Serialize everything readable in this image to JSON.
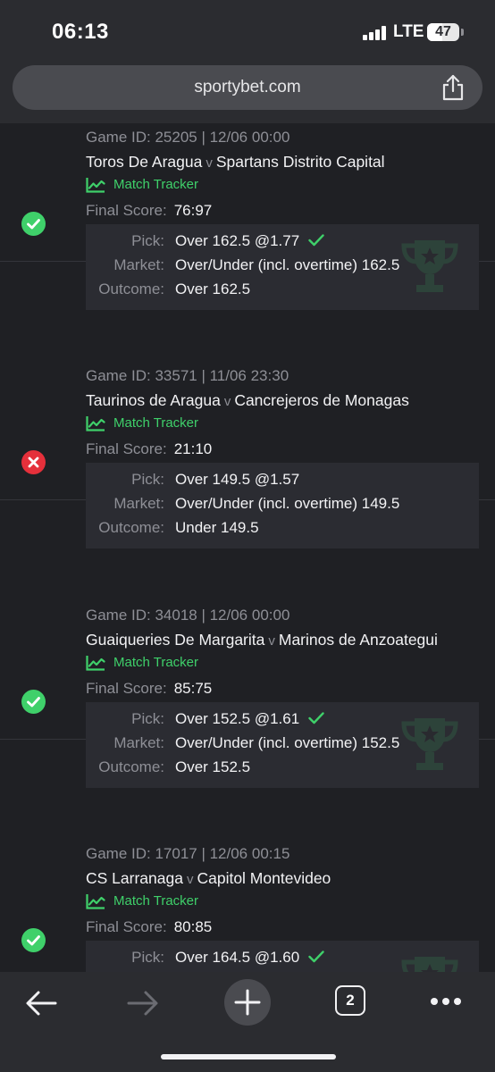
{
  "status_bar": {
    "time": "06:13",
    "network": "LTE",
    "battery": "47",
    "battery_level": 0.47
  },
  "browser": {
    "url": "sportybet.com",
    "tab_count": "2"
  },
  "labels": {
    "match_tracker": "Match Tracker",
    "final_score": "Final Score:",
    "pick": "Pick:",
    "market": "Market:",
    "outcome": "Outcome:",
    "vs": "v"
  },
  "bets": [
    {
      "result": "won",
      "game_id": "Game ID: 25205 | 12/06 00:00",
      "home": "Toros De Aragua",
      "away": "Spartans Distrito Capital",
      "final_score": "76:97",
      "pick": "Over 162.5 @1.77",
      "market": "Over/Under (incl. overtime) 162.5",
      "outcome": "Over 162.5"
    },
    {
      "result": "lost",
      "game_id": "Game ID: 33571 | 11/06 23:30",
      "home": "Taurinos de Aragua",
      "away": "Cancrejeros de Monagas",
      "final_score": "21:10",
      "pick": "Over 149.5 @1.57",
      "market": "Over/Under (incl. overtime) 149.5",
      "outcome": "Under 149.5"
    },
    {
      "result": "won",
      "game_id": "Game ID: 34018 | 12/06 00:00",
      "home": "Guaiqueries De Margarita",
      "away": "Marinos de Anzoategui",
      "final_score": "85:75",
      "pick": "Over 152.5 @1.61",
      "market": "Over/Under (incl. overtime) 152.5",
      "outcome": "Over 152.5"
    },
    {
      "result": "won",
      "game_id": "Game ID: 17017 | 12/06 00:15",
      "home": "CS Larranaga",
      "away": "Capitol Montevideo",
      "final_score": "80:85",
      "pick": "Over 164.5 @1.60",
      "market": "",
      "outcome": ""
    }
  ],
  "colors": {
    "win": "#3fd06a",
    "loss": "#e5303b",
    "background": "#1f2024",
    "panel": "#2b2c32"
  }
}
